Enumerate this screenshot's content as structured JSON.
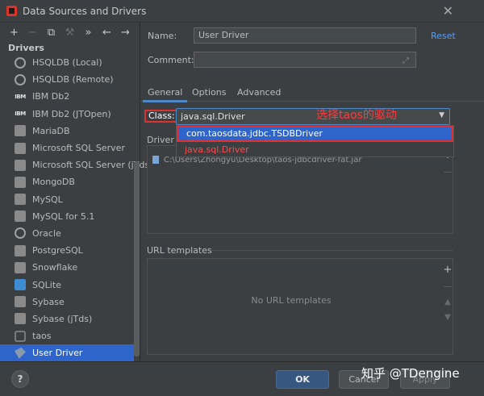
{
  "window": {
    "title": "Data Sources and Drivers"
  },
  "toolbar": {
    "add": "+",
    "remove": "−",
    "copy": "⧉",
    "settings": "🔧",
    "more": "»",
    "back": "←",
    "forward": "→"
  },
  "sidebar": {
    "heading": "Drivers",
    "items": [
      {
        "label": "HSQLDB (Local)",
        "icon": "hsqldb-icon"
      },
      {
        "label": "HSQLDB (Remote)",
        "icon": "hsqldb-icon"
      },
      {
        "label": "IBM Db2",
        "icon": "ibm-icon",
        "glyph": "IBM"
      },
      {
        "label": "IBM Db2 (JTOpen)",
        "icon": "ibm-icon",
        "glyph": "IBM"
      },
      {
        "label": "MariaDB",
        "icon": "mariadb-icon"
      },
      {
        "label": "Microsoft SQL Server",
        "icon": "mssql-icon"
      },
      {
        "label": "Microsoft SQL Server (jTds)",
        "icon": "mssql-icon"
      },
      {
        "label": "MongoDB",
        "icon": "mongodb-icon"
      },
      {
        "label": "MySQL",
        "icon": "mysql-icon"
      },
      {
        "label": "MySQL for 5.1",
        "icon": "mysql-icon"
      },
      {
        "label": "Oracle",
        "icon": "oracle-icon"
      },
      {
        "label": "PostgreSQL",
        "icon": "postgresql-icon"
      },
      {
        "label": "Snowflake",
        "icon": "snowflake-icon"
      },
      {
        "label": "SQLite",
        "icon": "sqlite-icon"
      },
      {
        "label": "Sybase",
        "icon": "sybase-icon"
      },
      {
        "label": "Sybase (jTds)",
        "icon": "sybase-icon"
      },
      {
        "label": "taos",
        "icon": "taos-icon"
      },
      {
        "label": "User Driver",
        "icon": "user-driver-icon",
        "selected": true
      }
    ]
  },
  "form": {
    "name_label": "Name:",
    "name_value": "User Driver",
    "reset_label": "Reset",
    "comment_label": "Comment:",
    "comment_value": ""
  },
  "tabs": [
    {
      "label": "General",
      "active": true
    },
    {
      "label": "Options",
      "active": false
    },
    {
      "label": "Advanced",
      "active": false
    }
  ],
  "class_field": {
    "label": "Class:",
    "value": "java.sql.Driver",
    "annotation": "选择taos的驱动",
    "options": [
      "com.taosdata.jdbc.TSDBDriver",
      "java.sql.Driver"
    ]
  },
  "driver_files": {
    "label": "Driver files",
    "entries": [
      "C:\\Users\\Zhongyu\\Desktop\\taos-jdbcdriver-fat.jar"
    ]
  },
  "url_templates": {
    "label": "URL templates",
    "empty_text": "No URL templates"
  },
  "footer": {
    "help": "?",
    "ok": "OK",
    "cancel": "Cancel",
    "apply": "Apply",
    "watermark": "知乎 @TDengine"
  },
  "colors": {
    "background": "#3c3f41",
    "selection": "#2f65ca",
    "link": "#589df6",
    "annotation_red": "#e03030"
  }
}
